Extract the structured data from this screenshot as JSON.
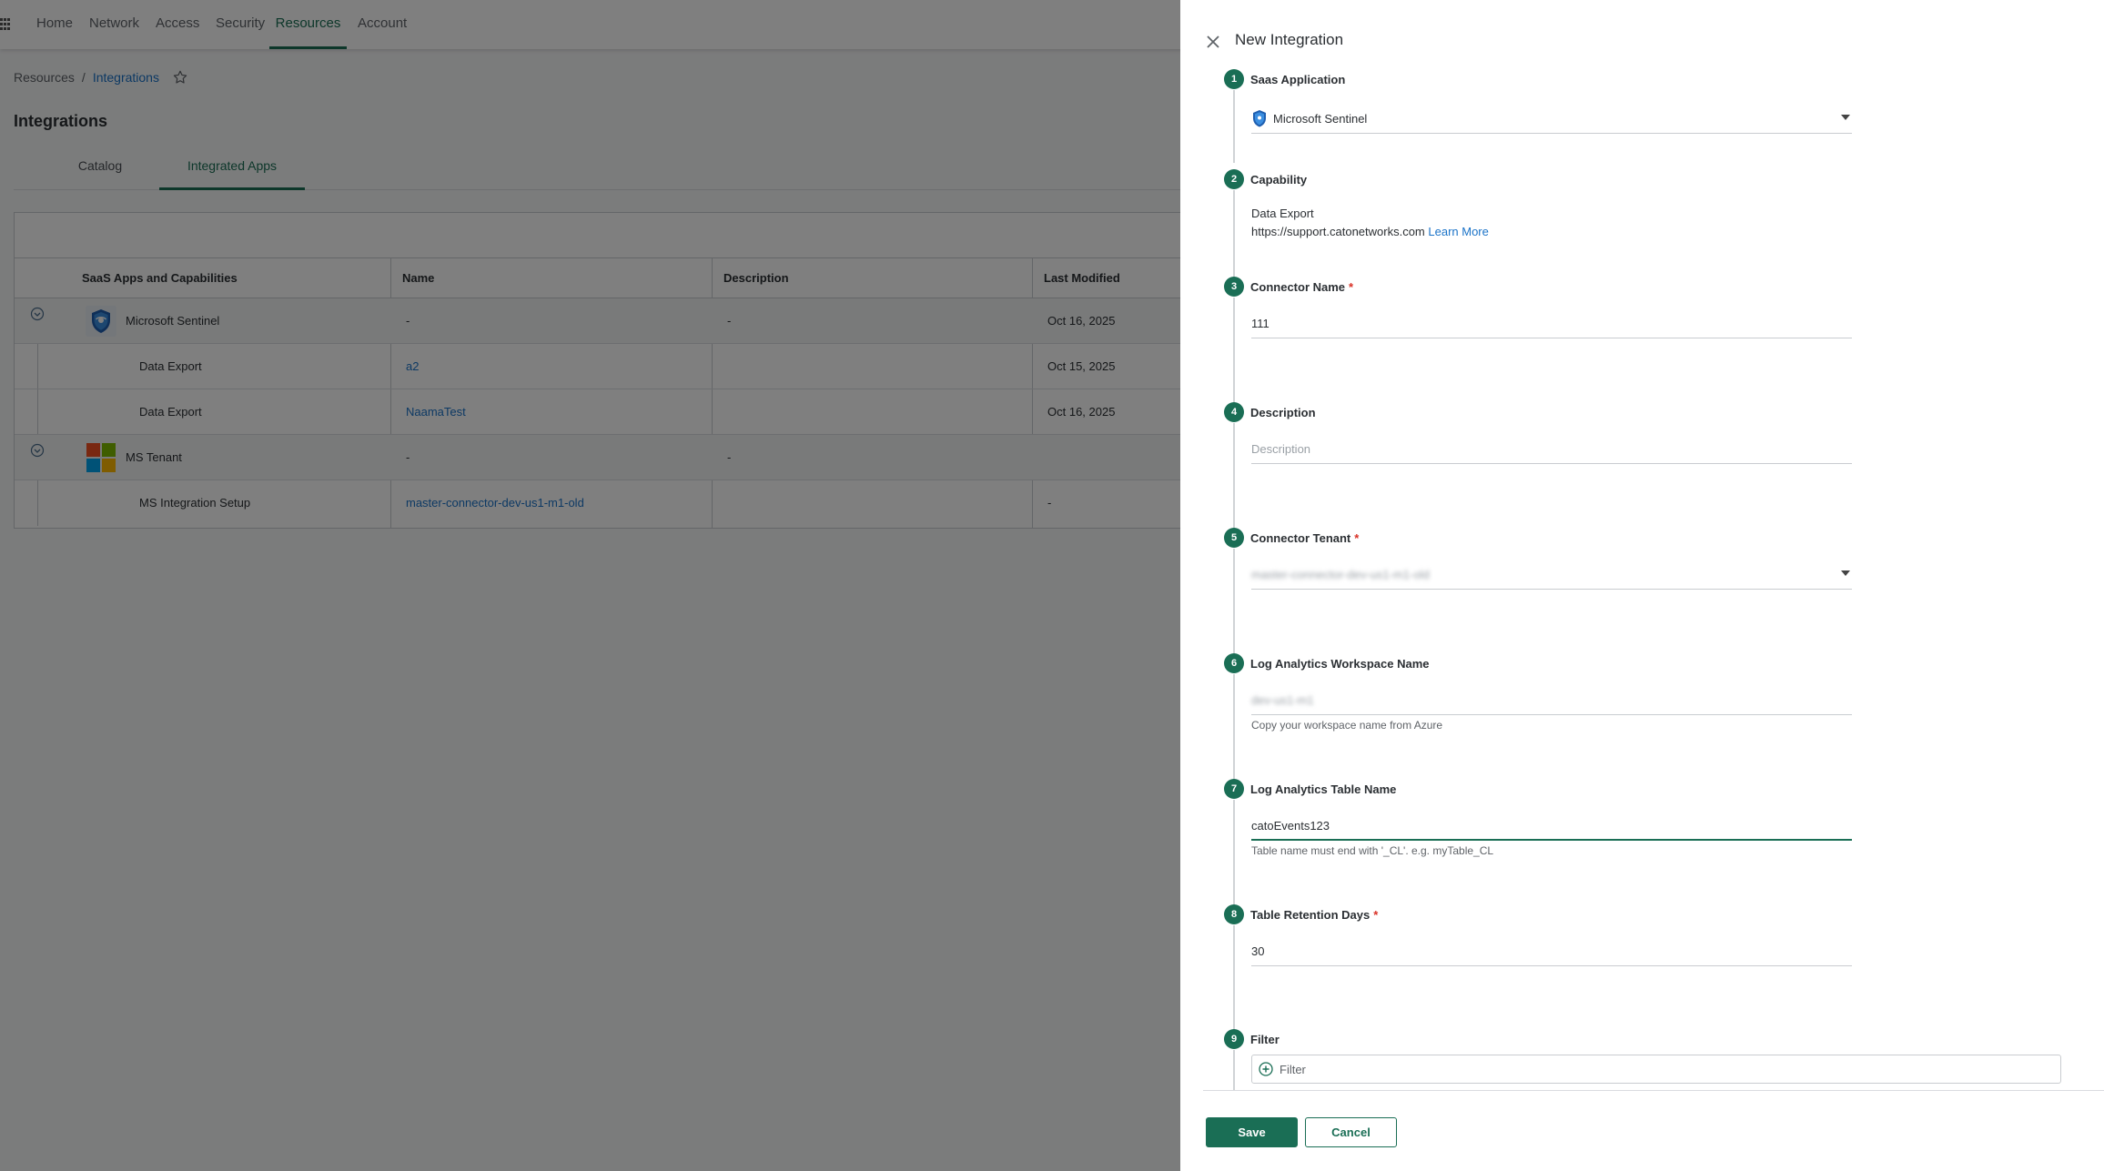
{
  "topnav": {
    "items": [
      "Home",
      "Network",
      "Access",
      "Security",
      "Resources",
      "Account"
    ],
    "active": "Resources"
  },
  "breadcrumb": {
    "root": "Resources",
    "separator": "/",
    "current": "Integrations"
  },
  "page_title": "Integrations",
  "tabs": [
    "Catalog",
    "Integrated Apps"
  ],
  "table": {
    "columns": [
      "SaaS Apps and Capabilities",
      "Name",
      "Description",
      "Last Modified"
    ],
    "rows": [
      {
        "app": "Microsoft Sentinel",
        "name": "-",
        "description": "-",
        "modified": "Oct 16, 2025"
      },
      {
        "app": "Data Export",
        "name": "a2",
        "description": "",
        "modified": "Oct 15, 2025"
      },
      {
        "app": "Data Export",
        "name": "NaamaTest",
        "description": "",
        "modified": "Oct 16, 2025"
      },
      {
        "app": "MS Tenant",
        "name": "-",
        "description": "-",
        "modified": ""
      },
      {
        "app": "MS Integration Setup",
        "name": "master-connector-dev-us1-m1-old",
        "description": "",
        "modified": "-"
      }
    ]
  },
  "panel": {
    "title": "New Integration",
    "steps": [
      {
        "num": "1",
        "label": "Saas Application",
        "value": "Microsoft Sentinel"
      },
      {
        "num": "2",
        "label": "Capability",
        "value": "Data Export",
        "url": "https://support.catonetworks.com",
        "link": "Learn More"
      },
      {
        "num": "3",
        "label": "Connector Name",
        "required": "*",
        "value": "111"
      },
      {
        "num": "4",
        "label": "Description",
        "placeholder": "Description"
      },
      {
        "num": "5",
        "label": "Connector Tenant",
        "required": "*",
        "value": "master-connector-dev-us1-m1-old"
      },
      {
        "num": "6",
        "label": "Log Analytics Workspace Name",
        "value": "dev-us1-m1",
        "helper": "Copy your workspace name from Azure"
      },
      {
        "num": "7",
        "label": "Log Analytics Table Name",
        "value": "catoEvents123",
        "helper": "Table name must end with '_CL'. e.g. myTable_CL"
      },
      {
        "num": "8",
        "label": "Table Retention Days",
        "required": "*",
        "value": "30"
      },
      {
        "num": "9",
        "label": "Filter",
        "placeholder": "Filter"
      }
    ],
    "save": "Save",
    "cancel": "Cancel"
  },
  "colors": {
    "accent": "#1a6e55",
    "link": "#1a73c8",
    "required": "#d93025"
  }
}
